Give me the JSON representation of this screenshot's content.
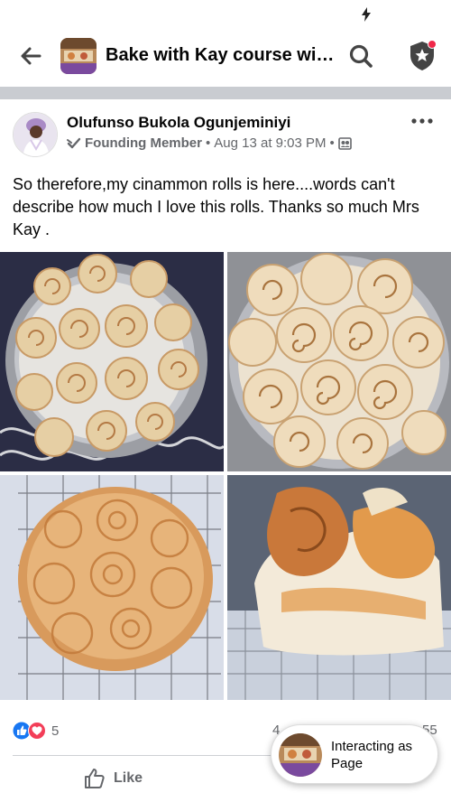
{
  "header": {
    "title": "Bake with Kay course wit…"
  },
  "post": {
    "author": "Olufunso Bukola Ogunjeminiyi",
    "badge": "Founding Member",
    "separator": "•",
    "date": "Aug 13 at 9:03 PM",
    "text": "So therefore,my cinammon rolls is here....words can't describe how much I love this rolls. Thanks so much Mrs Kay ."
  },
  "reactions": {
    "count": "5",
    "comments_partial": "4",
    "shares_partial": "55"
  },
  "actions": {
    "like": "Like"
  },
  "interacting": {
    "label": "Interacting as Page"
  },
  "icons": {
    "back": "arrow-left-icon",
    "search": "search-icon",
    "shield": "shield-star-icon",
    "more": "more-horizontal-icon",
    "badge": "founding-member-icon",
    "privacy": "group-members-icon",
    "like_reaction": "like-reaction-icon",
    "love_reaction": "love-reaction-icon",
    "like_button": "thumbs-up-icon",
    "status": "charging-bolt-icon"
  },
  "colors": {
    "brand_blue": "#1877f2",
    "love_red": "#f33e58",
    "notification_red": "#f02849",
    "secondary_text": "#65676b"
  }
}
